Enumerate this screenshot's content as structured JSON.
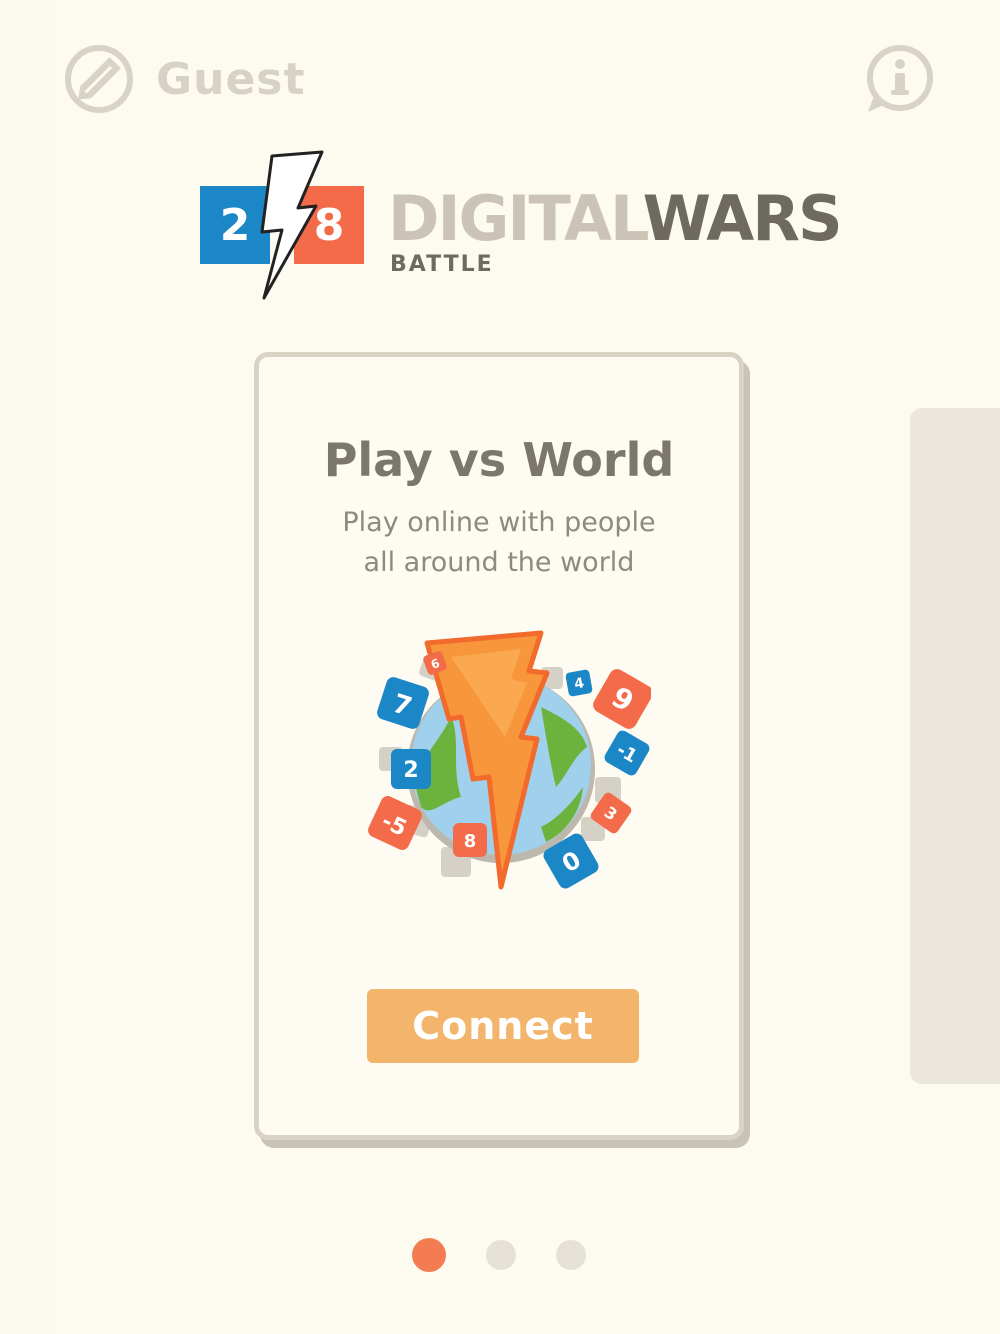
{
  "header": {
    "username": "Guest",
    "edit_icon": "pencil-icon",
    "info_icon": "info-icon"
  },
  "logo": {
    "tile_left": "2",
    "tile_right": "8",
    "title_part1": "DIGITAL",
    "title_part2": "WARS",
    "subtitle": "BATTLE"
  },
  "card": {
    "title": "Play vs World",
    "desc_line1": "Play online with people",
    "desc_line2": "all around the world",
    "illustration_icon": "globe-lightning-icon",
    "connect_label": "Connect",
    "tiles": [
      "7",
      "6",
      "2",
      "-5",
      "8",
      "0",
      "4",
      "9",
      "-1",
      "3"
    ]
  },
  "pager": {
    "pages": 3,
    "active": 0
  },
  "colors": {
    "background": "#fdfaf0",
    "blue": "#1c87c6",
    "red": "#f46b4a",
    "orange_button": "#f3b46c",
    "active_dot": "#f37c52",
    "inactive_dot": "#e5e1d8"
  }
}
